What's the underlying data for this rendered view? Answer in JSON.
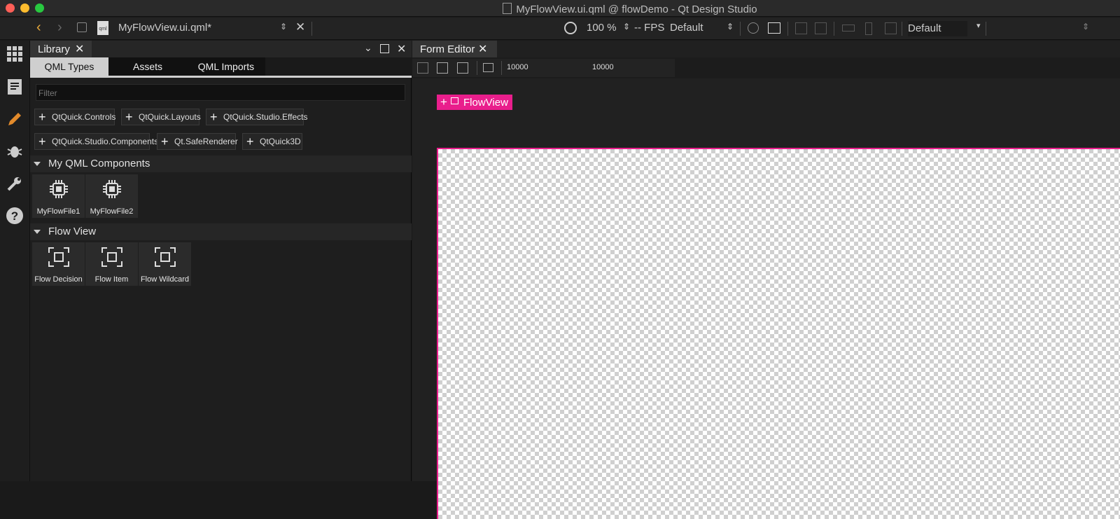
{
  "window": {
    "title": "MyFlowView.ui.qml @ flowDemo - Qt Design Studio"
  },
  "toolbar": {
    "file_name": "MyFlowView.ui.qml*",
    "zoom": "100 %",
    "fps": "-- FPS",
    "preset_left": "Default",
    "preset_right": "Default"
  },
  "library": {
    "tab_label": "Library",
    "subtabs": [
      "QML Types",
      "Assets",
      "QML Imports"
    ],
    "filter_placeholder": "Filter",
    "imports": [
      "QtQuick.Controls",
      "QtQuick.Layouts",
      "QtQuick.Studio.Effects",
      "QtQuick.Studio.Components",
      "Qt.SafeRenderer",
      "QtQuick3D"
    ],
    "sections": [
      {
        "title": "My QML Components",
        "items": [
          "MyFlowFile1",
          "MyFlowFile2"
        ]
      },
      {
        "title": "Flow View",
        "items": [
          "Flow Decision",
          "Flow Item",
          "Flow Wildcard"
        ]
      }
    ]
  },
  "editor": {
    "tab_label": "Form Editor",
    "width_value": "10000",
    "height_value": "10000",
    "root_item": "FlowView"
  },
  "colors": {
    "accent": "#e91e8c",
    "background": "#1e1e1e"
  }
}
